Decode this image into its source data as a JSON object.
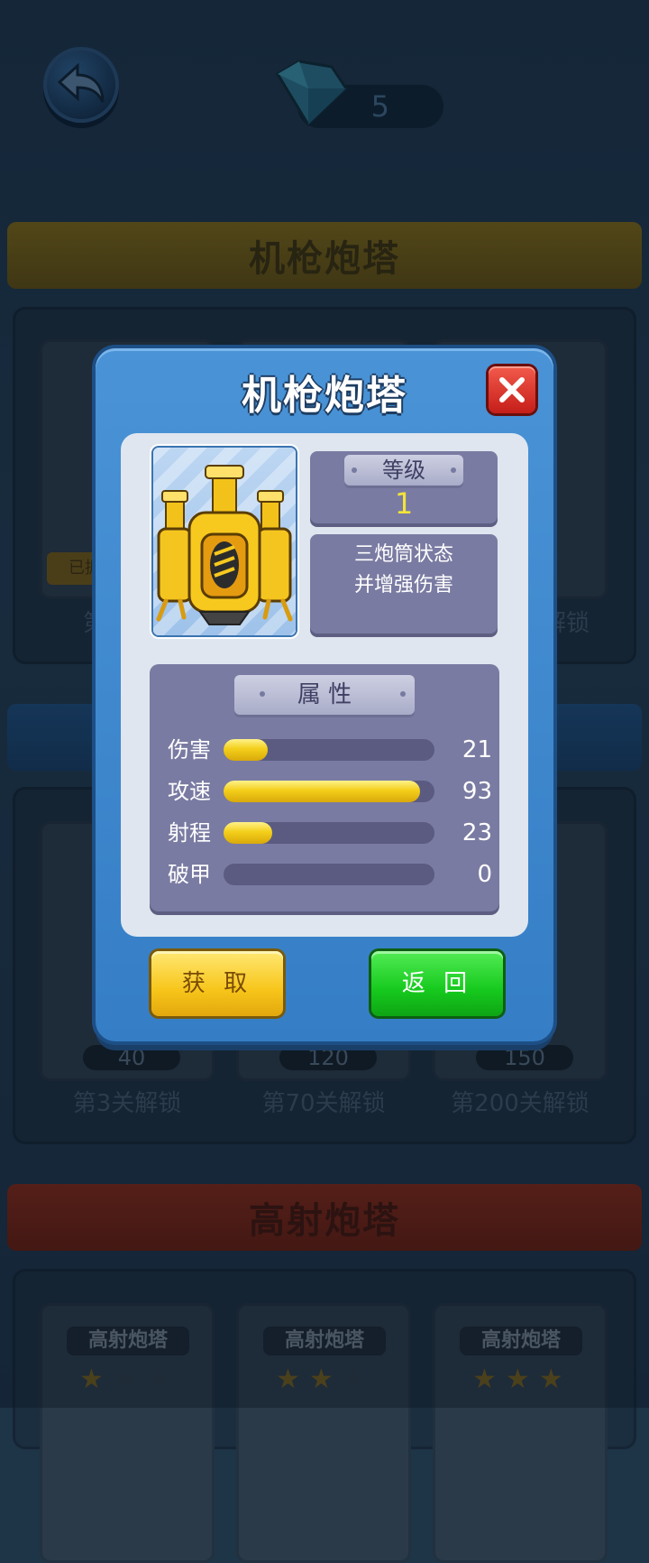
{
  "header": {
    "gem_count": "5"
  },
  "sections": [
    {
      "title": "机枪炮塔",
      "color": "#f2c616"
    },
    {
      "title": "",
      "color": "#2a82d6"
    },
    {
      "title": "高射炮塔",
      "color": "#e2421f"
    }
  ],
  "cards_row1": [
    {
      "owned_label": "已拥",
      "unlock": "第"
    },
    {
      "unlock": ""
    },
    {
      "unlock": "解锁"
    }
  ],
  "cards_row2": [
    {
      "price": "40",
      "unlock": "第3关解锁"
    },
    {
      "price": "120",
      "unlock": "第70关解锁"
    },
    {
      "price": "150",
      "unlock": "第200关解锁"
    }
  ],
  "cards_row3": [
    {
      "name": "高射炮塔",
      "stars_filled": 1
    },
    {
      "name": "高射炮塔",
      "stars_filled": 2
    },
    {
      "name": "高射炮塔",
      "stars_filled": 3
    }
  ],
  "dialog": {
    "title": "机枪炮塔",
    "level_label": "等级",
    "level_value": "1",
    "description_line1": "三炮筒状态",
    "description_line2": "并增强伤害",
    "attributes_label": "属 性",
    "stats": [
      {
        "label": "伤害",
        "value": 21,
        "max": 100
      },
      {
        "label": "攻速",
        "value": 93,
        "max": 100
      },
      {
        "label": "射程",
        "value": 23,
        "max": 100
      },
      {
        "label": "破甲",
        "value": 0,
        "max": 100
      }
    ],
    "get_button": "获 取",
    "back_button": "返 回"
  },
  "icons": {
    "back": "back-arrow-icon",
    "gem": "diamond-icon",
    "close": "close-icon",
    "turret": "turret-icon",
    "star": "star-icon"
  }
}
